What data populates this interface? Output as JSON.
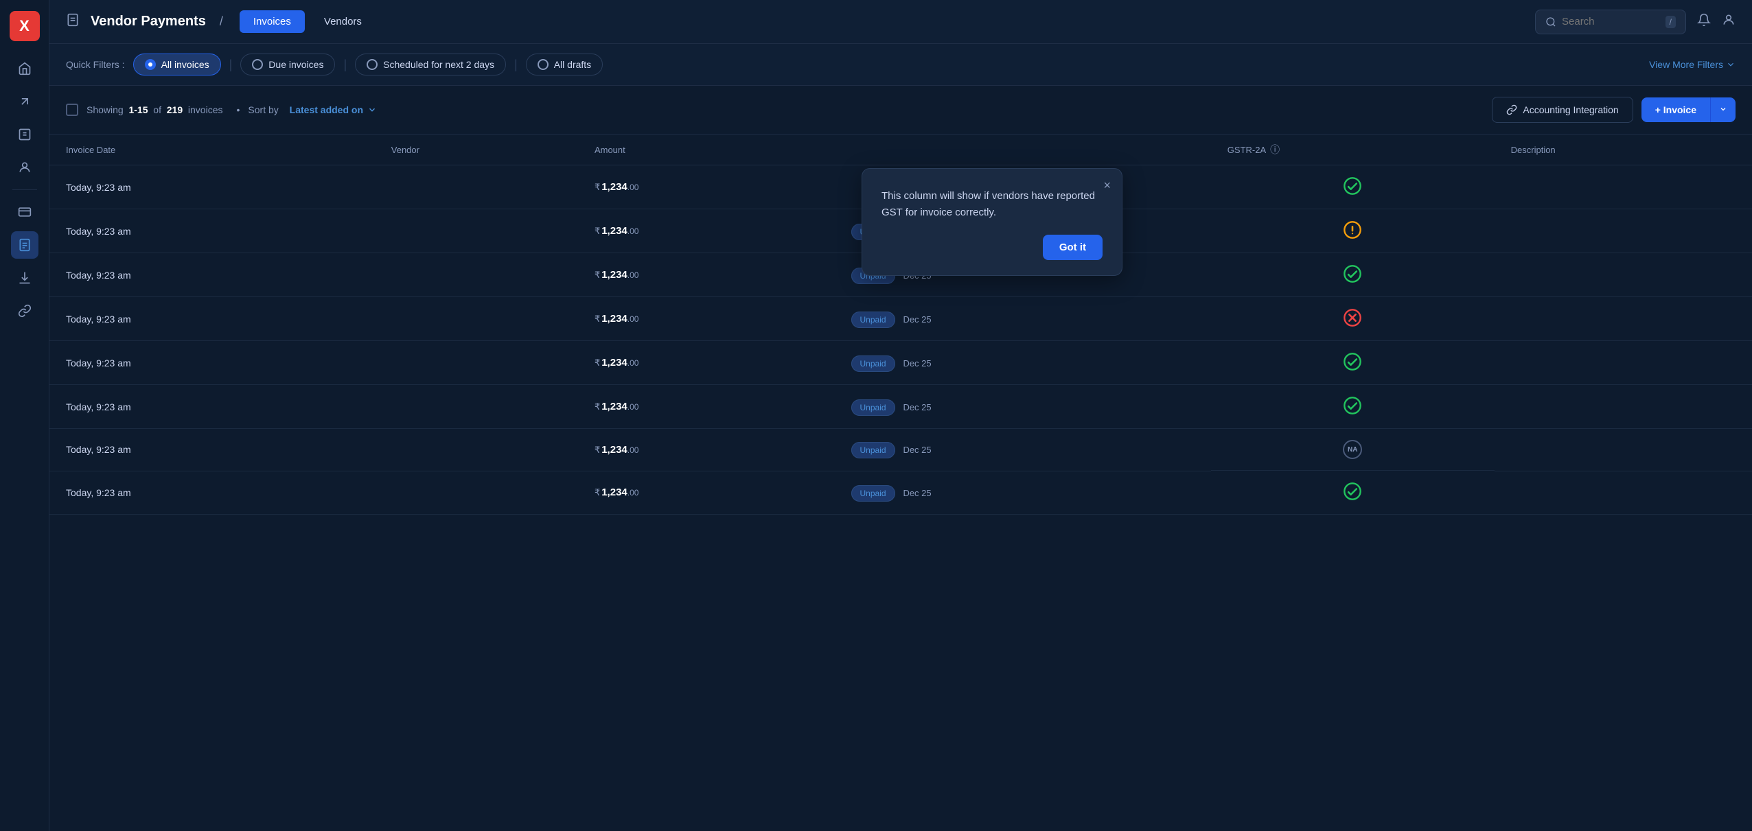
{
  "app": {
    "logo": "X",
    "title": "Vendor Payments",
    "separator": "/",
    "tabs": [
      {
        "id": "invoices",
        "label": "Invoices",
        "active": true
      },
      {
        "id": "vendors",
        "label": "Vendors",
        "active": false
      }
    ]
  },
  "topbar": {
    "search_placeholder": "Search",
    "kbd": "/",
    "icons": [
      "bell",
      "user"
    ]
  },
  "filters": {
    "quick_label": "Quick Filters :",
    "chips": [
      {
        "id": "all_invoices",
        "label": "All invoices",
        "active": true
      },
      {
        "id": "due_invoices",
        "label": "Due invoices",
        "active": false
      },
      {
        "id": "scheduled",
        "label": "Scheduled for next 2 days",
        "active": false
      },
      {
        "id": "all_drafts",
        "label": "All drafts",
        "active": false
      }
    ],
    "view_more": "View More Filters"
  },
  "toolbar": {
    "showing_prefix": "Showing",
    "range": "1-15",
    "of_text": "of",
    "total": "219",
    "invoices_label": "invoices",
    "sort_prefix": "Sort by",
    "sort_by": "Latest added on",
    "accounting_btn": "Accounting Integration",
    "add_invoice_btn": "+ Invoice"
  },
  "table": {
    "columns": [
      "Invoice Date",
      "Vendor",
      "Amount",
      "",
      "GSTR-2A",
      "Description"
    ],
    "rows": [
      {
        "date": "Today, 9:23 am",
        "vendor": "",
        "amount": "1,234",
        "decimals": ".00",
        "status": null,
        "due": null,
        "gstr": "check_green",
        "desc": ""
      },
      {
        "date": "Today, 9:23 am",
        "vendor": "",
        "amount": "1,234",
        "decimals": ".00",
        "status": "Unpaid",
        "due": "Dec 25",
        "gstr": "warn_orange",
        "desc": ""
      },
      {
        "date": "Today, 9:23 am",
        "vendor": "",
        "amount": "1,234",
        "decimals": ".00",
        "status": "Unpaid",
        "due": "Dec 25",
        "gstr": "check_green",
        "desc": ""
      },
      {
        "date": "Today, 9:23 am",
        "vendor": "",
        "amount": "1,234",
        "decimals": ".00",
        "status": "Unpaid",
        "due": "Dec 25",
        "gstr": "error_red",
        "desc": ""
      },
      {
        "date": "Today, 9:23 am",
        "vendor": "",
        "amount": "1,234",
        "decimals": ".00",
        "status": "Unpaid",
        "due": "Dec 25",
        "gstr": "check_green",
        "desc": ""
      },
      {
        "date": "Today, 9:23 am",
        "vendor": "",
        "amount": "1,234",
        "decimals": ".00",
        "status": "Unpaid",
        "due": "Dec 25",
        "gstr": "check_green",
        "desc": ""
      },
      {
        "date": "Today, 9:23 am",
        "vendor": "",
        "amount": "1,234",
        "decimals": ".00",
        "status": "Unpaid",
        "due": "Dec 25",
        "gstr": "na",
        "desc": ""
      },
      {
        "date": "Today, 9:23 am",
        "vendor": "",
        "amount": "1,234",
        "decimals": ".00",
        "status": "Unpaid",
        "due": "Dec 25",
        "gstr": "check_green",
        "desc": ""
      }
    ]
  },
  "tooltip": {
    "text": "This column will show if vendors have reported GST for invoice correctly.",
    "got_it": "Got it",
    "close_label": "×"
  },
  "sidebar": {
    "items": [
      {
        "id": "home",
        "icon": "⌂",
        "label": "Home"
      },
      {
        "id": "expand",
        "icon": "↗",
        "label": "Expand"
      },
      {
        "id": "documents",
        "icon": "📄",
        "label": "Documents"
      },
      {
        "id": "user",
        "icon": "👤",
        "label": "User"
      },
      {
        "id": "divider1"
      },
      {
        "id": "card",
        "icon": "💳",
        "label": "Card"
      },
      {
        "id": "active-item",
        "icon": "📋",
        "label": "Active",
        "active": true
      },
      {
        "id": "download",
        "icon": "⬇",
        "label": "Download"
      },
      {
        "id": "link",
        "icon": "🔗",
        "label": "Link"
      }
    ]
  }
}
